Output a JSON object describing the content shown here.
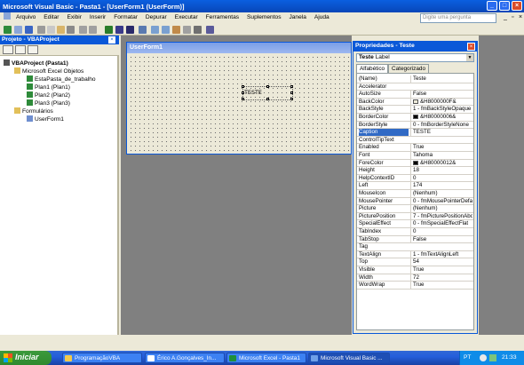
{
  "window": {
    "title": "Microsoft Visual Basic - Pasta1 - [UserForm1 (UserForm)]"
  },
  "menu": {
    "items": [
      "Arquivo",
      "Editar",
      "Exibir",
      "Inserir",
      "Formatar",
      "Depurar",
      "Executar",
      "Ferramentas",
      "Suplementos",
      "Janela",
      "Ajuda"
    ],
    "question_placeholder": "Digite uma pergunta"
  },
  "project": {
    "title": "Projeto - VBAProject",
    "tree": {
      "root": "VBAProject (Pasta1)",
      "excel_objects": "Microsoft Excel Objetos",
      "items": [
        "EstaPasta_de_trabalho",
        "Plan1 (Plan1)",
        "Plan2 (Plan2)",
        "Plan3 (Plan3)"
      ],
      "forms_folder": "Formulários",
      "form": "UserForm1"
    }
  },
  "userform": {
    "title": "UserForm1",
    "label_caption": "TESTE"
  },
  "properties": {
    "title": "Propriedades - Teste",
    "object_name": "Teste",
    "object_type": "Label",
    "tabs": [
      "Alfabético",
      "Categorizado"
    ],
    "rows": [
      {
        "name": "(Name)",
        "value": "Teste"
      },
      {
        "name": "Accelerator",
        "value": ""
      },
      {
        "name": "AutoSize",
        "value": "False"
      },
      {
        "name": "BackColor",
        "value": "&H8000000F&",
        "swatch": "#ece9d8"
      },
      {
        "name": "BackStyle",
        "value": "1 - fmBackStyleOpaque"
      },
      {
        "name": "BorderColor",
        "value": "&H80000006&",
        "swatch": "#000000"
      },
      {
        "name": "BorderStyle",
        "value": "0 - fmBorderStyleNone"
      },
      {
        "name": "Caption",
        "value": "TESTE",
        "selected": true
      },
      {
        "name": "ControlTipText",
        "value": ""
      },
      {
        "name": "Enabled",
        "value": "True"
      },
      {
        "name": "Font",
        "value": "Tahoma"
      },
      {
        "name": "ForeColor",
        "value": "&H80000012&",
        "swatch": "#000000"
      },
      {
        "name": "Height",
        "value": "18"
      },
      {
        "name": "HelpContextID",
        "value": "0"
      },
      {
        "name": "Left",
        "value": "174"
      },
      {
        "name": "MouseIcon",
        "value": "(Nenhum)"
      },
      {
        "name": "MousePointer",
        "value": "0 - fmMousePointerDefau"
      },
      {
        "name": "Picture",
        "value": "(Nenhum)"
      },
      {
        "name": "PicturePosition",
        "value": "7 - fmPicturePositionAbov"
      },
      {
        "name": "SpecialEffect",
        "value": "0 - fmSpecialEffectFlat"
      },
      {
        "name": "TabIndex",
        "value": "0"
      },
      {
        "name": "TabStop",
        "value": "False"
      },
      {
        "name": "Tag",
        "value": ""
      },
      {
        "name": "TextAlign",
        "value": "1 - fmTextAlignLeft"
      },
      {
        "name": "Top",
        "value": "54"
      },
      {
        "name": "Visible",
        "value": "True"
      },
      {
        "name": "Width",
        "value": "72"
      },
      {
        "name": "WordWrap",
        "value": "True"
      }
    ]
  },
  "taskbar": {
    "start": "Iniciar",
    "tasks": [
      {
        "label": "ProgramaçãoVBA",
        "icon_color": "#f2c94c"
      },
      {
        "label": "Érico A.Gonçalves_In...",
        "icon_color": "#ffffff"
      },
      {
        "label": "Microsoft Excel - Pasta1",
        "icon_color": "#1f8f3a"
      },
      {
        "label": "Microsoft Visual Basic ...",
        "icon_color": "#6fa0e8"
      }
    ],
    "lang": "PT",
    "time": "21:33"
  }
}
